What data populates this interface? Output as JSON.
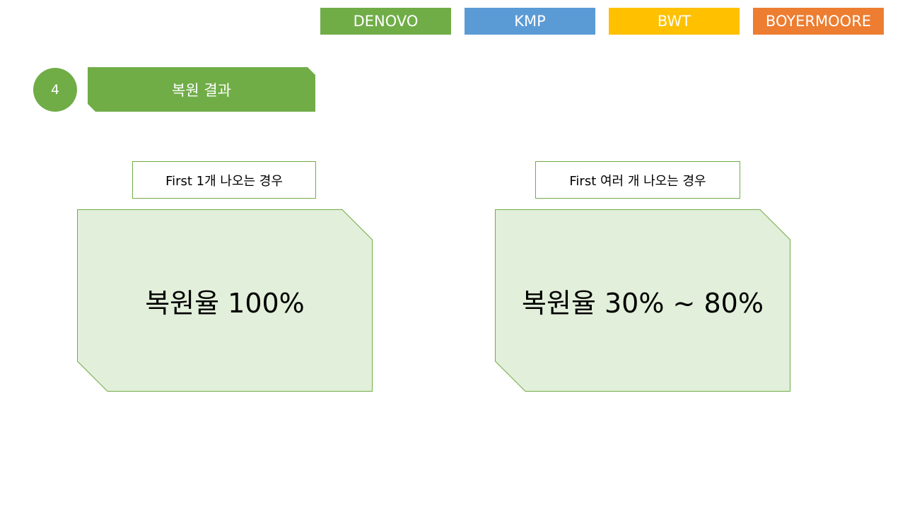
{
  "nav": {
    "tags": [
      {
        "label": "DENOVO",
        "color": "#70AD47"
      },
      {
        "label": "KMP",
        "color": "#5B9BD5"
      },
      {
        "label": "BWT",
        "color": "#FFC000"
      },
      {
        "label": "BOYERMOORE",
        "color": "#ED7D31"
      }
    ]
  },
  "section": {
    "number": "4",
    "title": "복원 결과"
  },
  "cases": [
    {
      "label": "First  1개 나오는 경우",
      "result": "복원율 100%"
    },
    {
      "label": "First  여러 개 나오는 경우",
      "result": "복원율 30% ~ 80%"
    }
  ],
  "colors": {
    "accent": "#70AD47",
    "card_fill": "#E2EFDA"
  }
}
